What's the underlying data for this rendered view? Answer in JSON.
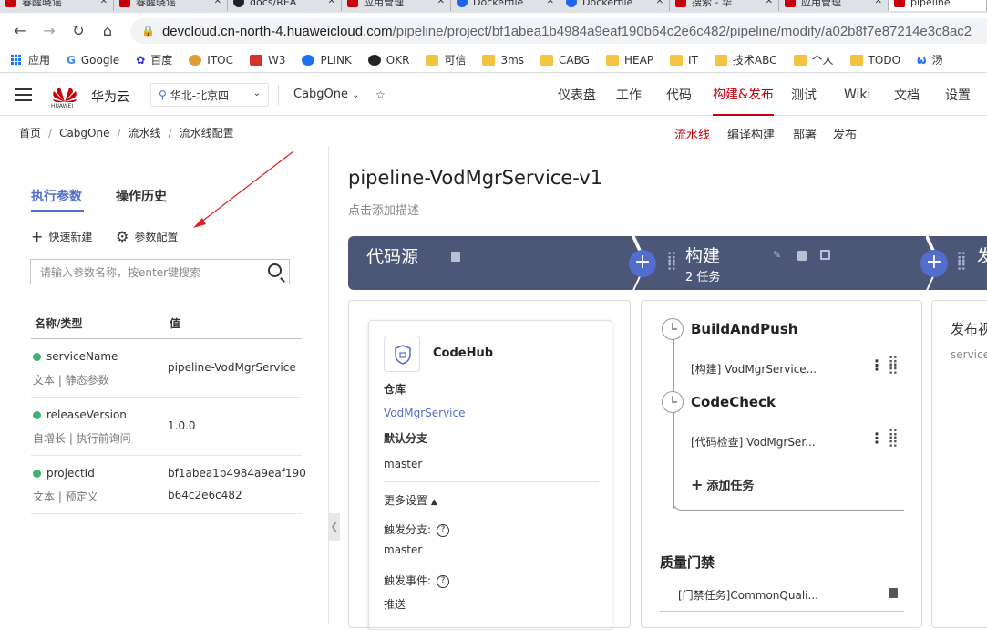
{
  "browser": {
    "tabs": [
      {
        "label": "春醒晓谣",
        "icon": "huawei-icon"
      },
      {
        "label": "春醒晓谣",
        "icon": "huawei-icon"
      },
      {
        "label": "docs/REA",
        "icon": "github-icon"
      },
      {
        "label": "应用管理",
        "icon": "huawei-icon"
      },
      {
        "label": "Dockerfile",
        "icon": "docker-icon"
      },
      {
        "label": "Dockerfile",
        "icon": "docker-icon"
      },
      {
        "label": "搜索 - 华",
        "icon": "huawei-icon"
      },
      {
        "label": "应用管理",
        "icon": "huawei-icon"
      },
      {
        "label": "pipeline",
        "icon": "huawei-icon"
      }
    ],
    "url_host": "devcloud.cn-north-4.huaweicloud.com",
    "url_path": "/pipeline/project/bf1abea1b4984a9eaf190b64c2e6c482/pipeline/modify/a02b8f7e87214e3c8ac2",
    "bookmarks": [
      "应用",
      "Google",
      "百度",
      "ITOC",
      "W3",
      "PLINK",
      "OKR",
      "可信",
      "3ms",
      "CABG",
      "HEAP",
      "IT",
      "技术ABC",
      "个人",
      "TODO",
      "汤"
    ]
  },
  "header": {
    "logo_text": "HUAWEI",
    "brand": "华为云",
    "region": "华北-北京四",
    "project": "CabgOne",
    "menu": [
      "仪表盘",
      "工作",
      "代码",
      "构建&发布",
      "测试",
      "Wiki",
      "文档",
      "设置"
    ],
    "active_menu": "构建&发布"
  },
  "breadcrumb": {
    "items": [
      "首页",
      "CabgOne",
      "流水线",
      "流水线配置"
    ],
    "separator": "/"
  },
  "subnav": [
    "流水线",
    "编译构建",
    "部署",
    "发布"
  ],
  "left_panel": {
    "tabs": [
      "执行参数",
      "操作历史"
    ],
    "actions": [
      "快速新建",
      "参数配置"
    ],
    "search_placeholder": "请输入参数名称，按enter键搜索",
    "columns": [
      "名称/类型",
      "值"
    ],
    "params": [
      {
        "name": "serviceName",
        "type": "文本 | 静态参数",
        "value": "pipeline-VodMgrService",
        "value2": ""
      },
      {
        "name": "releaseVersion",
        "type": "自增长 | 执行前询问",
        "value": "1.0.0",
        "value2": ""
      },
      {
        "name": "projectId",
        "type": "文本 | 预定义",
        "value": "bf1abea1b4984a9eaf190",
        "value2": "b64c2e6c482"
      }
    ]
  },
  "pipeline": {
    "title": "pipeline-VodMgrService-v1",
    "desc": "点击添加描述",
    "stages": [
      {
        "label": "代码源",
        "sub": ""
      },
      {
        "label": "构建",
        "sub": "2 任务"
      },
      {
        "label": "发",
        "sub": ""
      }
    ],
    "source": {
      "name": "CodeHub",
      "repo_label": "仓库",
      "repo": "VodMgrService",
      "branch_label": "默认分支",
      "branch": "master",
      "more": "更多设置",
      "trigger_branch_label": "触发分支:",
      "trigger_branch": "master",
      "trigger_event_label": "触发事件:",
      "trigger_event": "推送"
    },
    "build_jobs": [
      {
        "name": "BuildAndPush",
        "task": "[构建] VodMgrService..."
      },
      {
        "name": "CodeCheck",
        "task": "[代码检查] VodMgrSer..."
      }
    ],
    "add_task": "添加任务",
    "quality_gate": {
      "title": "质量门禁",
      "task": "[门禁任务]CommonQuali..."
    },
    "release": {
      "title": "发布视",
      "sub": "serviceN"
    }
  }
}
